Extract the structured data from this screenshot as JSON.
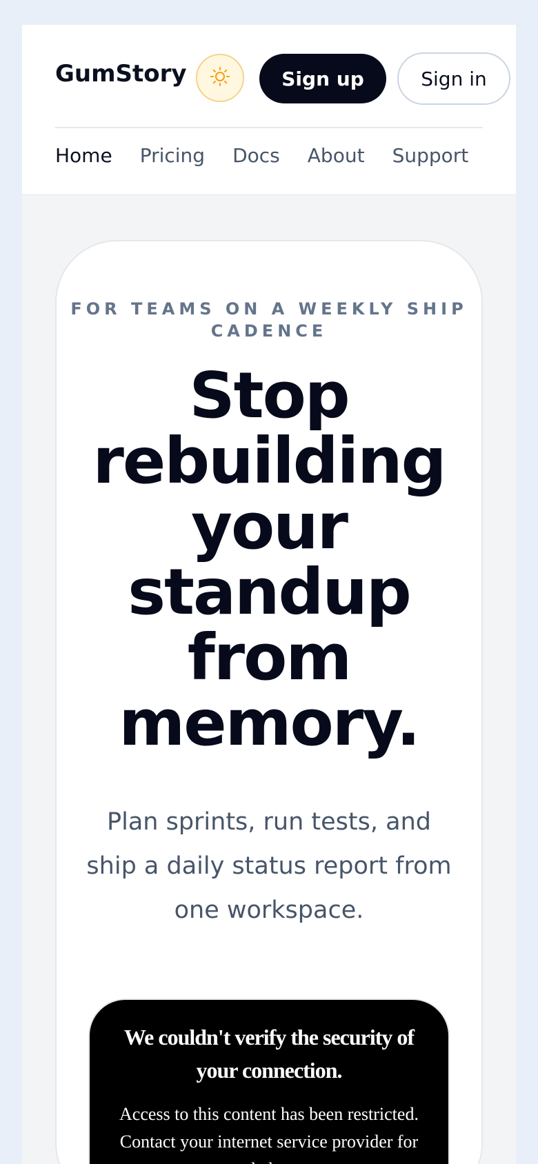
{
  "header": {
    "brand": "GumStory",
    "theme_icon": "sun-icon",
    "signup_label": "Sign up",
    "signin_label": "Sign in"
  },
  "nav": {
    "items": [
      {
        "label": "Home",
        "active": true
      },
      {
        "label": "Pricing",
        "active": false
      },
      {
        "label": "Docs",
        "active": false
      },
      {
        "label": "About",
        "active": false
      },
      {
        "label": "Support",
        "active": false
      }
    ]
  },
  "hero": {
    "eyebrow": "For teams on a weekly ship cadence",
    "headline": "Stop rebuilding your standup from memory.",
    "subhead": "Plan sprints, run tests, and ship a daily status report from one workspace."
  },
  "error_notice": {
    "title": "We couldn't verify the security of your connection.",
    "message": "Access to this content has been restricted. Contact your internet service provider for help."
  },
  "colors": {
    "background": "#e9eff9",
    "primary": "#060a1a",
    "muted_text": "#475569",
    "accent_sun": "#f59e0b"
  }
}
